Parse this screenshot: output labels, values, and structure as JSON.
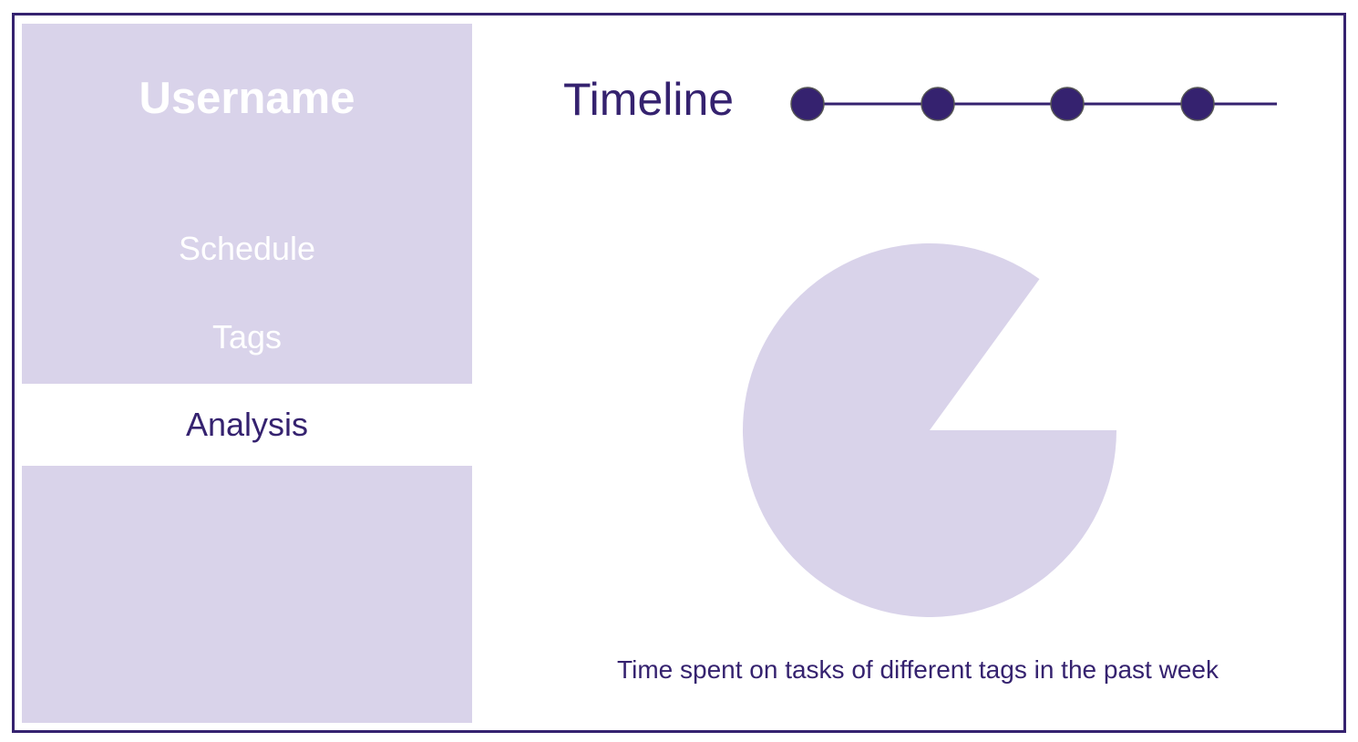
{
  "sidebar": {
    "username": "Username",
    "items": [
      {
        "label": "Schedule",
        "active": false
      },
      {
        "label": "Tags",
        "active": false
      },
      {
        "label": "Analysis",
        "active": true
      }
    ]
  },
  "main": {
    "timeline_label": "Timeline",
    "timeline_points": 4,
    "caption": "Time spent on tasks of different tags in the past week"
  },
  "colors": {
    "accent": "#35226f",
    "sidebar_bg": "#d9d3ea",
    "pie_fill": "#d9d3ea",
    "background": "#ffffff"
  },
  "chart_data": {
    "type": "pie",
    "slices": [
      {
        "value": 0.85
      },
      {
        "value": 0.15,
        "missing": true
      }
    ]
  }
}
